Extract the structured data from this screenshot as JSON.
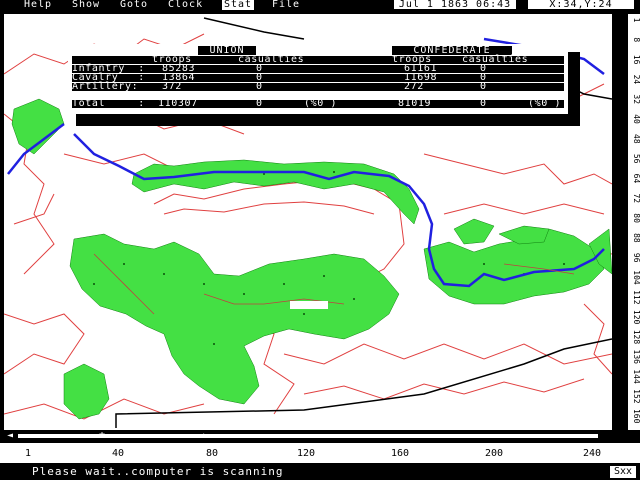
{
  "menu": {
    "items": [
      {
        "label": "Help"
      },
      {
        "label": "Show"
      },
      {
        "label": "Goto"
      },
      {
        "label": "Clock"
      },
      {
        "label": "Stat"
      },
      {
        "label": "File"
      }
    ],
    "selected": "Stat"
  },
  "datetime": "Jul 1 1863 06:43",
  "coords": "X:34,Y:24",
  "stats": {
    "union_header": "UNION",
    "confed_header": "CONFEDERATE",
    "col_troops": "troops",
    "col_casualties": "casualties",
    "rows": [
      {
        "label": "Infantry  :",
        "u_troops": "85283",
        "u_cas": "0",
        "c_troops": "61161",
        "c_cas": "0"
      },
      {
        "label": "Cavalry   :",
        "u_troops": "13864",
        "u_cas": "0",
        "c_troops": "11698",
        "c_cas": "0"
      },
      {
        "label": "Artillery:",
        "u_troops": "372",
        "u_cas": "0",
        "c_troops": "272",
        "c_cas": "0"
      }
    ],
    "total": {
      "label": "Total     :",
      "u_troops": "110307",
      "u_cas": "0",
      "u_pct": "(%0 )",
      "c_troops": "81019",
      "c_cas": "0",
      "c_pct": "(%0 )"
    }
  },
  "ruler_y": [
    "1",
    "8",
    "16",
    "24",
    "32",
    "40",
    "48",
    "56",
    "64",
    "72",
    "80",
    "88",
    "96",
    "104",
    "112",
    "120",
    "128",
    "136",
    "144",
    "152",
    "160"
  ],
  "ruler_x": [
    "1",
    "40",
    "80",
    "120",
    "160",
    "200",
    "240"
  ],
  "status": "Please wait..computer is scanning",
  "zoom_indicator": "Sxx",
  "colors": {
    "contour": "#e04040",
    "forest": "#44e044",
    "river": "#2020e0",
    "road": "#000000"
  }
}
